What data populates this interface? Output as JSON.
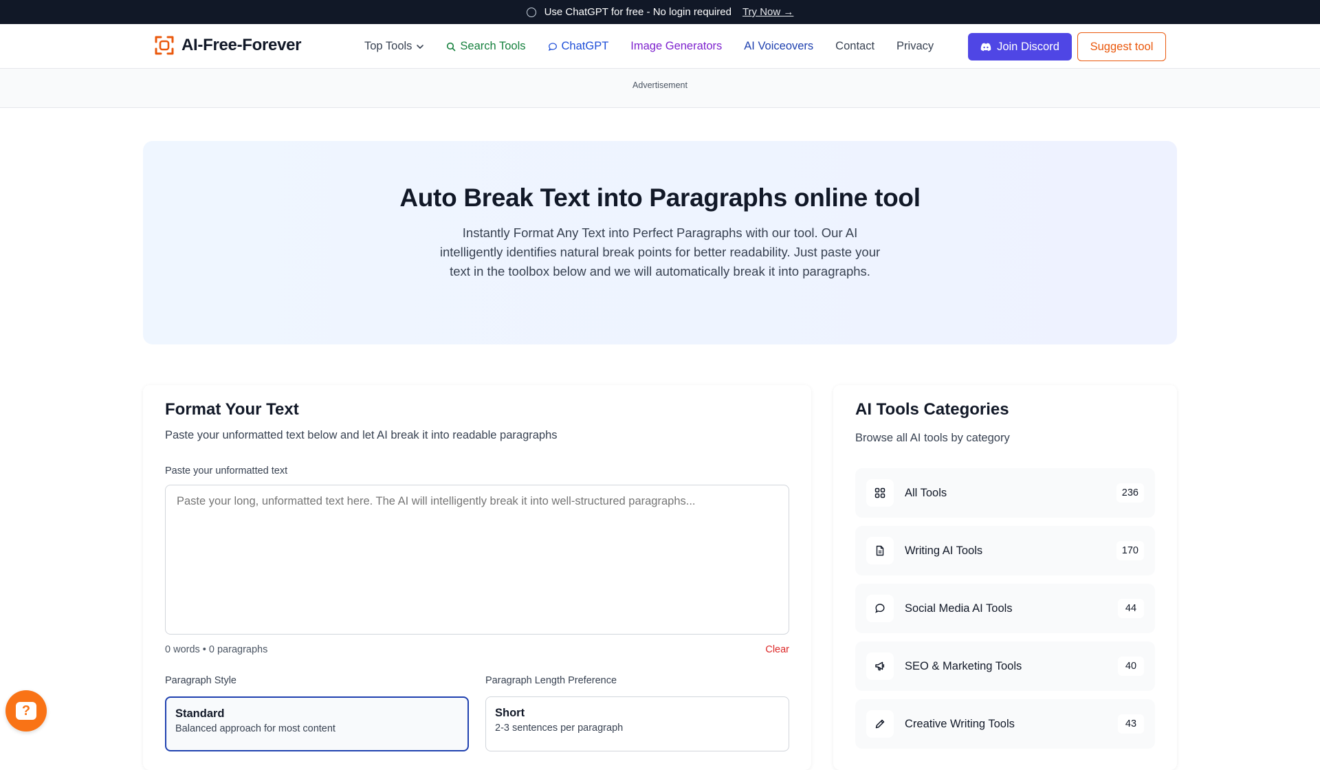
{
  "topbar": {
    "message": "Use ChatGPT for free - No login required",
    "cta": "Try Now →"
  },
  "header": {
    "logo_text": "AI-Free-Forever",
    "nav": [
      {
        "label": "Top Tools",
        "color": "#374151"
      },
      {
        "label": "Search Tools",
        "color": "#15803d"
      },
      {
        "label": "ChatGPT",
        "color": "#1d4ed8"
      },
      {
        "label": "Image Generators",
        "color": "#7e22ce"
      },
      {
        "label": "AI Voiceovers",
        "color": "#1e40af"
      },
      {
        "label": "Contact",
        "color": "#374151"
      },
      {
        "label": "Privacy",
        "color": "#374151"
      }
    ],
    "discord_label": "Join Discord",
    "suggest_label": "Suggest tool"
  },
  "ad": {
    "label": "Advertisement"
  },
  "hero": {
    "title": "Auto Break Text into Paragraphs online tool",
    "description": "Instantly Format Any Text into Perfect Paragraphs with our tool. Our AI intelligently identifies natural break points for better readability. Just paste your text in the toolbox below and we will automatically break it into paragraphs."
  },
  "formatter": {
    "title": "Format Your Text",
    "subtitle": "Paste your unformatted text below and let AI break it into readable paragraphs",
    "input_label": "Paste your unformatted text",
    "input_placeholder": "Paste your long, unformatted text here. The AI will intelligently break it into well-structured paragraphs...",
    "input_value": "",
    "counts": "0 words • 0 paragraphs",
    "clear_label": "Clear",
    "style_label": "Paragraph Style",
    "length_label": "Paragraph Length Preference",
    "style_option": {
      "title": "Standard",
      "desc": "Balanced approach for most content"
    },
    "length_option": {
      "title": "Short",
      "desc": "2-3 sentences per paragraph"
    }
  },
  "categories": {
    "title": "AI Tools Categories",
    "subtitle": "Browse all AI tools by category",
    "items": [
      {
        "name": "All Tools",
        "count": "236",
        "icon": "grid-icon"
      },
      {
        "name": "Writing AI Tools",
        "count": "170",
        "icon": "document-icon"
      },
      {
        "name": "Social Media AI Tools",
        "count": "44",
        "icon": "chat-bubble-icon"
      },
      {
        "name": "SEO & Marketing Tools",
        "count": "40",
        "icon": "megaphone-icon"
      },
      {
        "name": "Creative Writing Tools",
        "count": "43",
        "icon": "pencil-icon"
      }
    ]
  },
  "colors": {
    "accent_orange": "#ea580c",
    "discord": "#4f46e5",
    "selected_border": "#1e40af",
    "clear_red": "#dc2626"
  }
}
